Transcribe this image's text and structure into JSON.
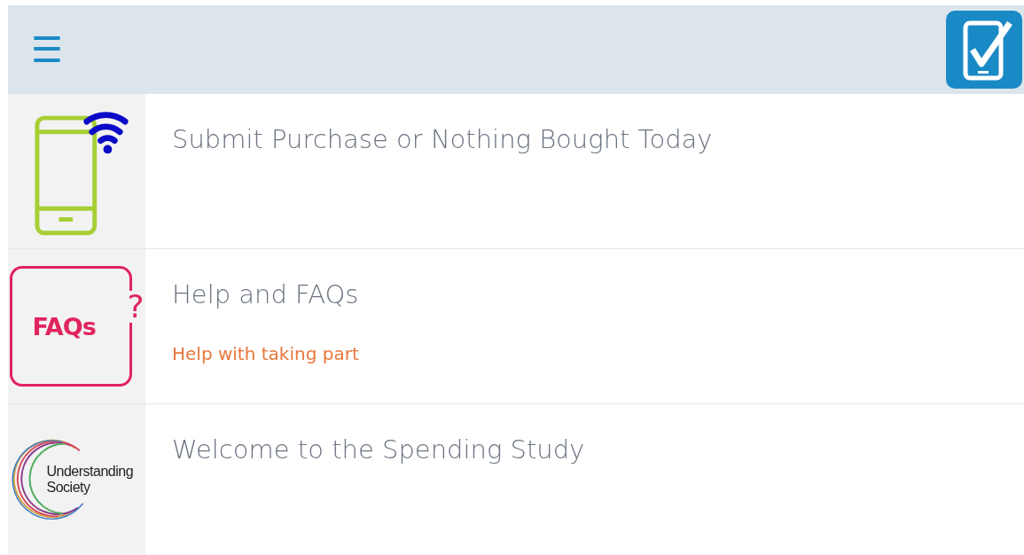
{
  "header": {
    "menu_label": "☰"
  },
  "items": [
    {
      "kind": "phone",
      "title": "Submit Purchase or Nothing Bought Today"
    },
    {
      "kind": "faq",
      "title": "Help and FAQs",
      "subtitle": "Help with taking part",
      "icon_text": "FAQs",
      "icon_mark": "?"
    },
    {
      "kind": "logo",
      "title": "Welcome to the Spending Study",
      "icon_lines": [
        "Understanding",
        "Society"
      ]
    }
  ]
}
